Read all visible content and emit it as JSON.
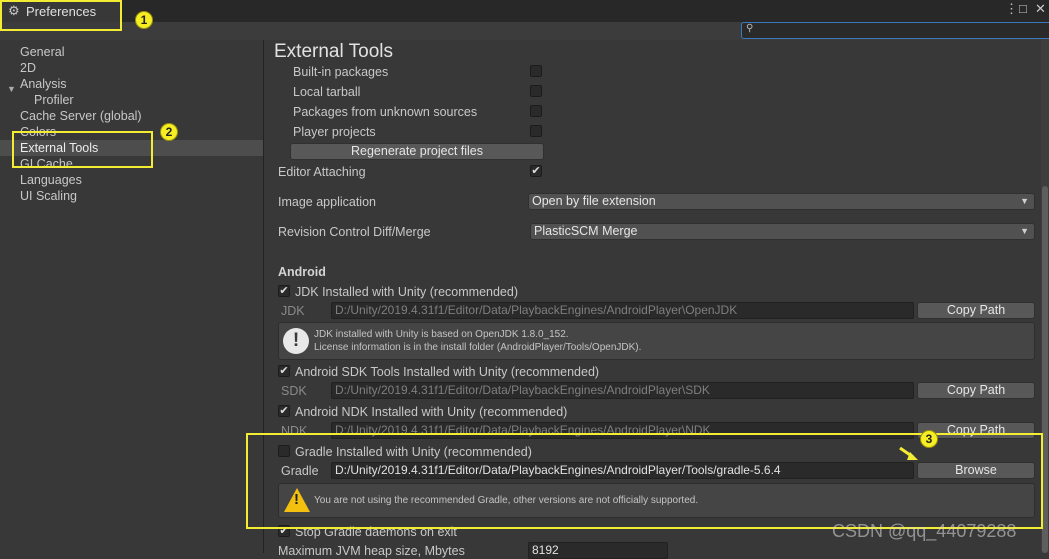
{
  "window": {
    "tab_title": "Preferences",
    "gear_icon": "⚙",
    "more_icon": "⋮",
    "maximize_icon": "□",
    "close_icon": "✕",
    "search_icon": "⚲",
    "search_value": ""
  },
  "sidebar": {
    "items": [
      "General",
      "2D",
      "Analysis",
      "Profiler",
      "Cache Server (global)",
      "Colors",
      "External Tools",
      "GI Cache",
      "Languages",
      "UI Scaling"
    ],
    "selected": "External Tools",
    "foldout_icon": "▼"
  },
  "content": {
    "title": "External Tools",
    "generate_options": [
      {
        "label": "Built-in packages",
        "checked": false
      },
      {
        "label": "Local tarball",
        "checked": false
      },
      {
        "label": "Packages from unknown sources",
        "checked": false
      },
      {
        "label": "Player projects",
        "checked": false
      }
    ],
    "regenerate_button": "Regenerate project files",
    "editor_attaching": {
      "label": "Editor Attaching",
      "checked": true
    },
    "image_application": {
      "label": "Image application",
      "value": "Open by file extension"
    },
    "revision_control": {
      "label": "Revision Control Diff/Merge",
      "value": "PlasticSCM Merge"
    },
    "dropdown_arrow": "▼",
    "check_mark": "✔",
    "android": {
      "header": "Android",
      "jdk": {
        "checkbox_label": "JDK Installed with Unity (recommended)",
        "checked": true,
        "field_label": "JDK",
        "path": "D:/Unity/2019.4.31f1/Editor/Data/PlaybackEngines/AndroidPlayer\\OpenJDK",
        "button": "Copy Path",
        "info_icon": "!",
        "info_line1": "JDK installed with Unity is based on OpenJDK 1.8.0_152.",
        "info_line2": "License information is in the install folder (AndroidPlayer/Tools/OpenJDK)."
      },
      "sdk": {
        "checkbox_label": "Android SDK Tools Installed with Unity (recommended)",
        "checked": true,
        "field_label": "SDK",
        "path": "D:/Unity/2019.4.31f1/Editor/Data/PlaybackEngines/AndroidPlayer\\SDK",
        "button": "Copy Path"
      },
      "ndk": {
        "checkbox_label": "Android NDK Installed with Unity (recommended)",
        "checked": true,
        "field_label": "NDK",
        "path": "D:/Unity/2019.4.31f1/Editor/Data/PlaybackEngines/AndroidPlayer\\NDK",
        "button": "Copy Path"
      },
      "gradle": {
        "checkbox_label": "Gradle Installed with Unity (recommended)",
        "checked": false,
        "field_label": "Gradle",
        "path": "D:/Unity/2019.4.31f1/Editor/Data/PlaybackEngines/AndroidPlayer/Tools/gradle-5.6.4",
        "button": "Browse",
        "warning_icon": "!",
        "warning_text": "You are not using the recommended Gradle, other versions are not officially supported."
      },
      "stop_gradle": {
        "label": "Stop Gradle daemons on exit",
        "checked": true
      },
      "jvm_heap": {
        "label": "Maximum JVM heap size, Mbytes",
        "value": "8192"
      }
    }
  },
  "annotations": {
    "badge_1": "1",
    "badge_2": "2",
    "badge_3": "3",
    "highlight_color": "#f2ec32"
  },
  "watermark": "CSDN @qq_44079288"
}
